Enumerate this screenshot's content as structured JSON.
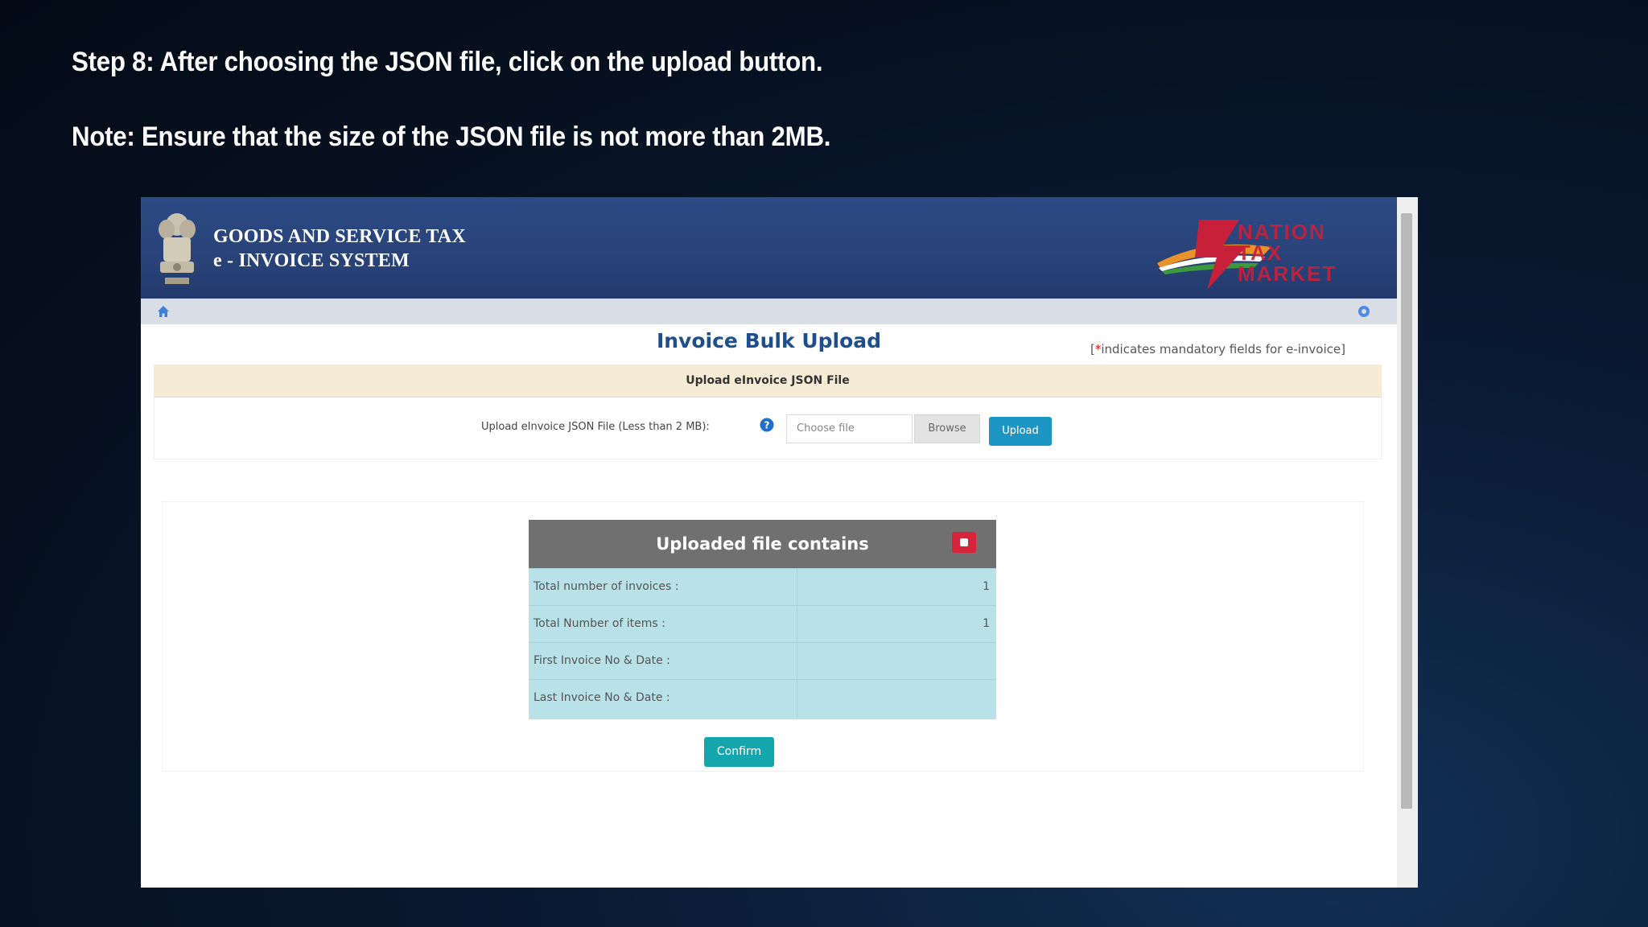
{
  "slide": {
    "step_text": "Step 8: After choosing the JSON file, click on the upload button.",
    "note_text": "Note: Ensure that the size of the JSON file is not more than 2MB."
  },
  "portal": {
    "title_line1": "GOODS AND SERVICE TAX",
    "title_line2": "e - INVOICE SYSTEM",
    "brand_lines": [
      "NATION",
      "TAX",
      "MARKET"
    ],
    "brand_color": "#c8203a",
    "header_color": "#2c4a85",
    "nav_icons": {
      "left": "home-icon",
      "right": "gear-icon"
    }
  },
  "page": {
    "title": "Invoice Bulk Upload",
    "mandatory_star": "*",
    "mandatory_note": "indicates mandatory fields for e-invoice"
  },
  "upload_panel": {
    "heading": "Upload eInvoice JSON File",
    "label": "Upload eInvoice JSON File (Less than 2 MB):",
    "file_placeholder": "Choose file",
    "browse_label": "Browse",
    "upload_label": "Upload",
    "accent": "#1e96c4"
  },
  "result": {
    "heading": "Uploaded file contains",
    "rows": [
      {
        "label": "Total number of invoices :",
        "value": "1"
      },
      {
        "label": "Total Number of items :",
        "value": "1"
      },
      {
        "label": "First Invoice No & Date :",
        "value": ""
      },
      {
        "label": "Last Invoice No & Date :",
        "value": ""
      }
    ],
    "confirm_label": "Confirm"
  }
}
